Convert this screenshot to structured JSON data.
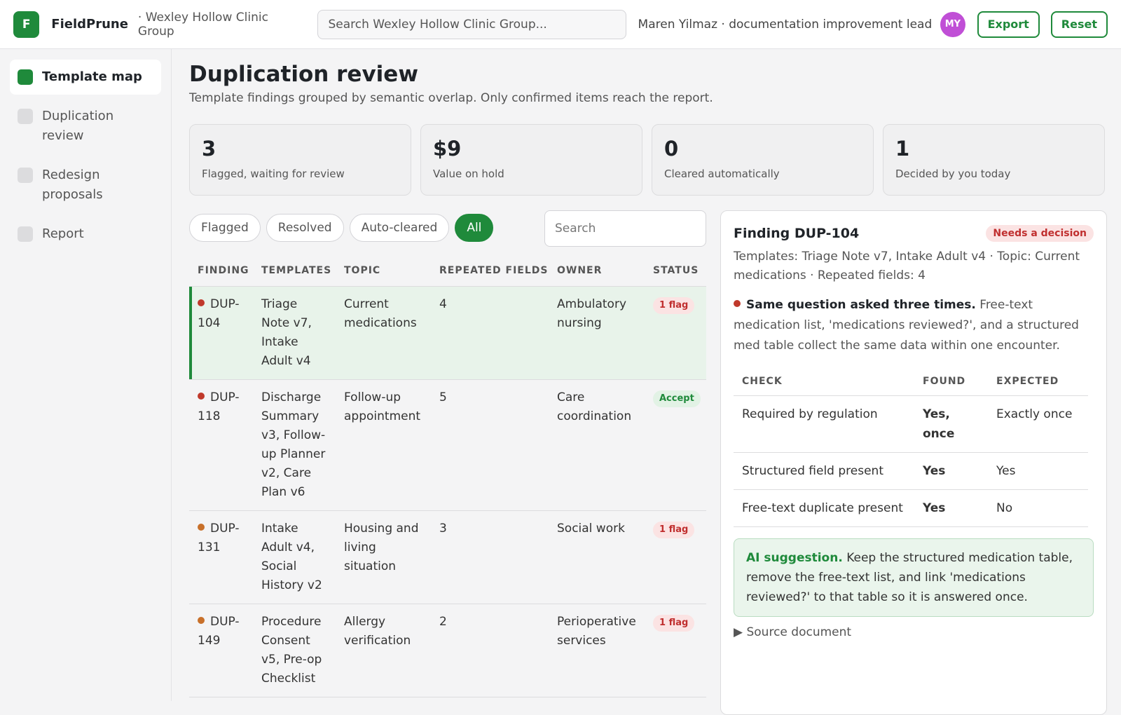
{
  "header": {
    "logo_letter": "F",
    "app_name": "FieldPrune",
    "org": "· Wexley Hollow Clinic Group",
    "search_placeholder": "Search Wexley Hollow Clinic Group...",
    "user": "Maren Yilmaz · documentation improvement lead",
    "avatar_initials": "MY",
    "export_label": "Export",
    "reset_label": "Reset"
  },
  "sidebar": {
    "items": [
      {
        "label": "Template map",
        "active": true
      },
      {
        "label": "Duplication review",
        "active": false
      },
      {
        "label": "Redesign proposals",
        "active": false
      },
      {
        "label": "Report",
        "active": false
      }
    ]
  },
  "page": {
    "title": "Duplication review",
    "subtitle": "Template findings grouped by semantic overlap. Only confirmed items reach the report."
  },
  "stats": [
    {
      "value": "3",
      "label": "Flagged, waiting for review"
    },
    {
      "value": "$9",
      "label": "Value on hold"
    },
    {
      "value": "0",
      "label": "Cleared automatically"
    },
    {
      "value": "1",
      "label": "Decided by you today"
    }
  ],
  "filters": {
    "chips": [
      "Flagged",
      "Resolved",
      "Auto-cleared",
      "All"
    ],
    "active": "All",
    "search_placeholder": "Search"
  },
  "table": {
    "headers": [
      "FINDING",
      "TEMPLATES",
      "TOPIC",
      "REPEATED FIELDS",
      "OWNER",
      "STATUS"
    ],
    "rows": [
      {
        "id": "DUP-104",
        "dot": "#c0392b",
        "templates": "Triage Note v7, Intake Adult v4",
        "topic": "Current medications",
        "repeated": "4",
        "owner": "Ambulatory nursing",
        "status": "1 flag",
        "status_type": "flag",
        "selected": true
      },
      {
        "id": "DUP-118",
        "dot": "#c0392b",
        "templates": "Discharge Summary v3, Follow-up Planner v2, Care Plan v6",
        "topic": "Follow-up appointment",
        "repeated": "5",
        "owner": "Care coordination",
        "status": "Accept",
        "status_type": "accept",
        "selected": false
      },
      {
        "id": "DUP-131",
        "dot": "#c8702a",
        "templates": "Intake Adult v4, Social History v2",
        "topic": "Housing and living situation",
        "repeated": "3",
        "owner": "Social work",
        "status": "1 flag",
        "status_type": "flag",
        "selected": false
      },
      {
        "id": "DUP-149",
        "dot": "#c8702a",
        "templates": "Procedure Consent v5, Pre-op Checklist",
        "topic": "Allergy verification",
        "repeated": "2",
        "owner": "Perioperative services",
        "status": "1 flag",
        "status_type": "flag",
        "selected": false
      }
    ]
  },
  "detail": {
    "title": "Finding DUP-104",
    "badge": "Needs a decision",
    "meta": "Templates: Triage Note v7, Intake Adult v4 · Topic: Current medications · Repeated fields: 4",
    "finding_title": "Same question asked three times.",
    "finding_text": " Free-text medication list, 'medications reviewed?', and a structured med table collect the same data within one encounter.",
    "checks_headers": [
      "CHECK",
      "FOUND",
      "EXPECTED"
    ],
    "checks": [
      {
        "check": "Required by regulation",
        "found": "Yes, once",
        "found_color": "green",
        "expected": "Exactly once"
      },
      {
        "check": "Structured field present",
        "found": "Yes",
        "found_color": "green",
        "expected": "Yes"
      },
      {
        "check": "Free-text duplicate present",
        "found": "Yes",
        "found_color": "red",
        "expected": "No"
      }
    ],
    "ai_label": "AI suggestion.",
    "ai_text": " Keep the structured medication table, remove the free-text list, and link 'medications reviewed?' to that table so it is answered once.",
    "source_label": "Source document"
  }
}
